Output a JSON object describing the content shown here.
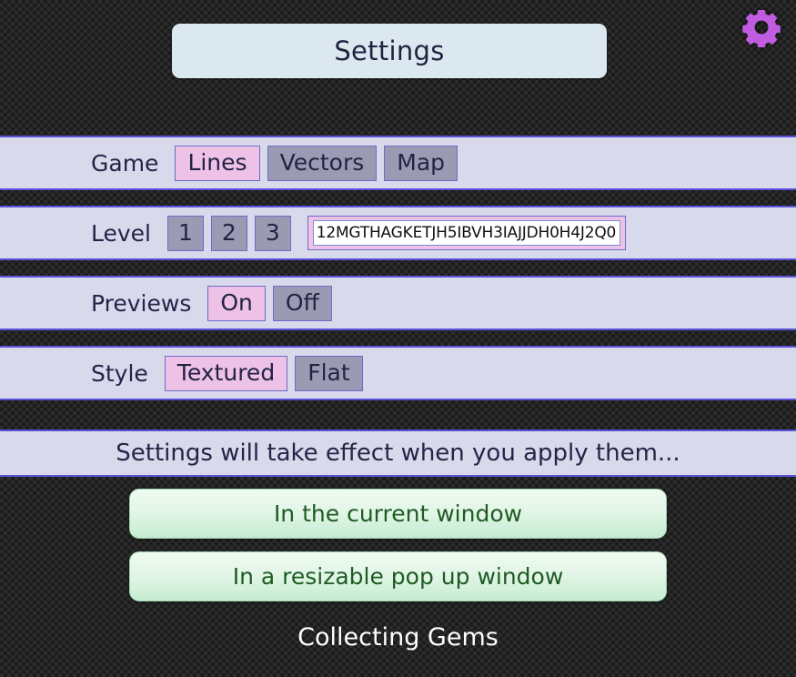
{
  "header": {
    "title": "Settings",
    "gear_icon": "gear-icon",
    "gear_color": "#bf5ce0",
    "title_bg": "#dce8f0"
  },
  "settings": {
    "game": {
      "label": "Game",
      "options": [
        {
          "label": "Lines",
          "selected": true
        },
        {
          "label": "Vectors",
          "selected": false
        },
        {
          "label": "Map",
          "selected": false
        }
      ]
    },
    "level": {
      "label": "Level",
      "options": [
        {
          "label": "1",
          "selected": false
        },
        {
          "label": "2",
          "selected": false
        },
        {
          "label": "3",
          "selected": false
        }
      ],
      "code_value": "12MGTHAGKETJH5IBVH3IAJJDH0H4J2Q0",
      "code_placeholder": ""
    },
    "previews": {
      "label": "Previews",
      "options": [
        {
          "label": "On",
          "selected": true
        },
        {
          "label": "Off",
          "selected": false
        }
      ]
    },
    "style": {
      "label": "Style",
      "options": [
        {
          "label": "Textured",
          "selected": true
        },
        {
          "label": "Flat",
          "selected": false
        }
      ]
    }
  },
  "message": "Settings will take effect when you apply them...",
  "actions": [
    {
      "label": "In the current window"
    },
    {
      "label": "In a resizable pop up window"
    }
  ],
  "footer": "Collecting Gems",
  "colors": {
    "selected": "#eec2e6",
    "unselected": "#9a9ab2",
    "band": "#d9d9ec",
    "band_border": "#5a52d8",
    "accent_green": "#1f5b22"
  }
}
